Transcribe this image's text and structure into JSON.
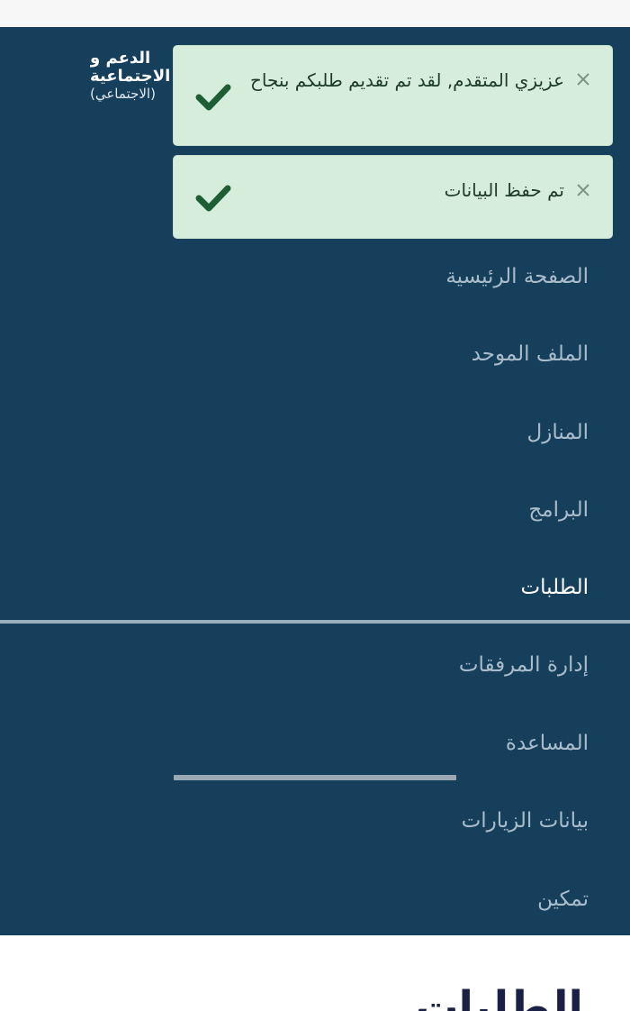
{
  "header": {
    "org_name_line1": "الدعم و",
    "org_name_line2": "الاجتماعية",
    "org_name_line3": "(الاجتماعي)"
  },
  "notifications": [
    {
      "message": "عزيزي المتقدم, لقد تم تقديم طلبكم بنجاح",
      "icon": "check-icon",
      "close_icon": "close-icon"
    },
    {
      "message": "تم حفظ البيانات",
      "icon": "check-icon",
      "close_icon": "close-icon"
    }
  ],
  "menu": {
    "items": [
      {
        "label": "الصفحة الرئيسية",
        "active": false
      },
      {
        "label": "الملف الموحد",
        "active": false
      },
      {
        "label": "المنازل",
        "active": false
      },
      {
        "label": "البرامج",
        "active": false
      },
      {
        "label": "الطلبات",
        "active": true
      },
      {
        "label": "إدارة المرفقات",
        "active": false
      },
      {
        "label": "المساعدة",
        "active": false
      },
      {
        "label": "بيانات الزيارات",
        "active": false
      },
      {
        "label": "تمكين",
        "active": false
      }
    ]
  },
  "page": {
    "heading": "الطلبات"
  },
  "colors": {
    "nav_background": "#163f5c",
    "toast_background": "#d6eddb",
    "check_green": "#1d5e35",
    "heading": "#1b2046"
  }
}
